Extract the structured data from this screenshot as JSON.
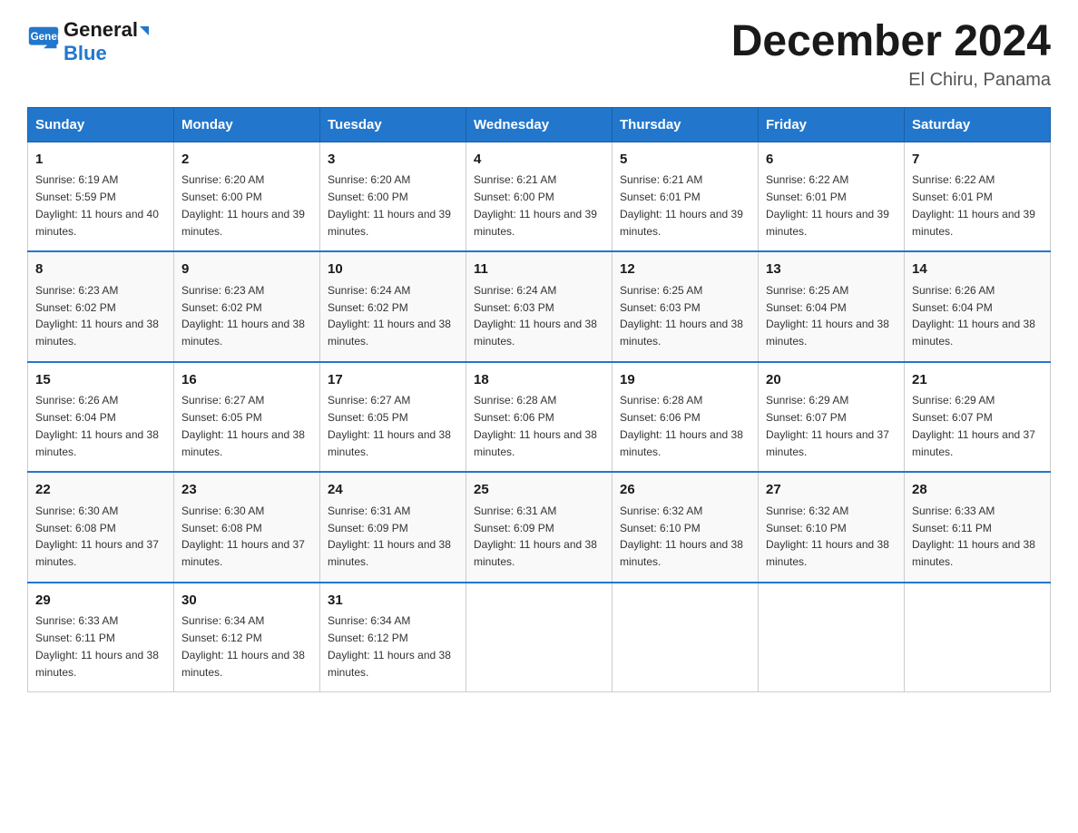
{
  "logo": {
    "text_general": "General",
    "icon_symbol": "▶",
    "text_blue": "Blue"
  },
  "title": "December 2024",
  "location": "El Chiru, Panama",
  "days_of_week": [
    "Sunday",
    "Monday",
    "Tuesday",
    "Wednesday",
    "Thursday",
    "Friday",
    "Saturday"
  ],
  "weeks": [
    [
      {
        "day": "1",
        "sunrise": "6:19 AM",
        "sunset": "5:59 PM",
        "daylight": "11 hours and 40 minutes."
      },
      {
        "day": "2",
        "sunrise": "6:20 AM",
        "sunset": "6:00 PM",
        "daylight": "11 hours and 39 minutes."
      },
      {
        "day": "3",
        "sunrise": "6:20 AM",
        "sunset": "6:00 PM",
        "daylight": "11 hours and 39 minutes."
      },
      {
        "day": "4",
        "sunrise": "6:21 AM",
        "sunset": "6:00 PM",
        "daylight": "11 hours and 39 minutes."
      },
      {
        "day": "5",
        "sunrise": "6:21 AM",
        "sunset": "6:01 PM",
        "daylight": "11 hours and 39 minutes."
      },
      {
        "day": "6",
        "sunrise": "6:22 AM",
        "sunset": "6:01 PM",
        "daylight": "11 hours and 39 minutes."
      },
      {
        "day": "7",
        "sunrise": "6:22 AM",
        "sunset": "6:01 PM",
        "daylight": "11 hours and 39 minutes."
      }
    ],
    [
      {
        "day": "8",
        "sunrise": "6:23 AM",
        "sunset": "6:02 PM",
        "daylight": "11 hours and 38 minutes."
      },
      {
        "day": "9",
        "sunrise": "6:23 AM",
        "sunset": "6:02 PM",
        "daylight": "11 hours and 38 minutes."
      },
      {
        "day": "10",
        "sunrise": "6:24 AM",
        "sunset": "6:02 PM",
        "daylight": "11 hours and 38 minutes."
      },
      {
        "day": "11",
        "sunrise": "6:24 AM",
        "sunset": "6:03 PM",
        "daylight": "11 hours and 38 minutes."
      },
      {
        "day": "12",
        "sunrise": "6:25 AM",
        "sunset": "6:03 PM",
        "daylight": "11 hours and 38 minutes."
      },
      {
        "day": "13",
        "sunrise": "6:25 AM",
        "sunset": "6:04 PM",
        "daylight": "11 hours and 38 minutes."
      },
      {
        "day": "14",
        "sunrise": "6:26 AM",
        "sunset": "6:04 PM",
        "daylight": "11 hours and 38 minutes."
      }
    ],
    [
      {
        "day": "15",
        "sunrise": "6:26 AM",
        "sunset": "6:04 PM",
        "daylight": "11 hours and 38 minutes."
      },
      {
        "day": "16",
        "sunrise": "6:27 AM",
        "sunset": "6:05 PM",
        "daylight": "11 hours and 38 minutes."
      },
      {
        "day": "17",
        "sunrise": "6:27 AM",
        "sunset": "6:05 PM",
        "daylight": "11 hours and 38 minutes."
      },
      {
        "day": "18",
        "sunrise": "6:28 AM",
        "sunset": "6:06 PM",
        "daylight": "11 hours and 38 minutes."
      },
      {
        "day": "19",
        "sunrise": "6:28 AM",
        "sunset": "6:06 PM",
        "daylight": "11 hours and 38 minutes."
      },
      {
        "day": "20",
        "sunrise": "6:29 AM",
        "sunset": "6:07 PM",
        "daylight": "11 hours and 37 minutes."
      },
      {
        "day": "21",
        "sunrise": "6:29 AM",
        "sunset": "6:07 PM",
        "daylight": "11 hours and 37 minutes."
      }
    ],
    [
      {
        "day": "22",
        "sunrise": "6:30 AM",
        "sunset": "6:08 PM",
        "daylight": "11 hours and 37 minutes."
      },
      {
        "day": "23",
        "sunrise": "6:30 AM",
        "sunset": "6:08 PM",
        "daylight": "11 hours and 37 minutes."
      },
      {
        "day": "24",
        "sunrise": "6:31 AM",
        "sunset": "6:09 PM",
        "daylight": "11 hours and 38 minutes."
      },
      {
        "day": "25",
        "sunrise": "6:31 AM",
        "sunset": "6:09 PM",
        "daylight": "11 hours and 38 minutes."
      },
      {
        "day": "26",
        "sunrise": "6:32 AM",
        "sunset": "6:10 PM",
        "daylight": "11 hours and 38 minutes."
      },
      {
        "day": "27",
        "sunrise": "6:32 AM",
        "sunset": "6:10 PM",
        "daylight": "11 hours and 38 minutes."
      },
      {
        "day": "28",
        "sunrise": "6:33 AM",
        "sunset": "6:11 PM",
        "daylight": "11 hours and 38 minutes."
      }
    ],
    [
      {
        "day": "29",
        "sunrise": "6:33 AM",
        "sunset": "6:11 PM",
        "daylight": "11 hours and 38 minutes."
      },
      {
        "day": "30",
        "sunrise": "6:34 AM",
        "sunset": "6:12 PM",
        "daylight": "11 hours and 38 minutes."
      },
      {
        "day": "31",
        "sunrise": "6:34 AM",
        "sunset": "6:12 PM",
        "daylight": "11 hours and 38 minutes."
      },
      null,
      null,
      null,
      null
    ]
  ]
}
